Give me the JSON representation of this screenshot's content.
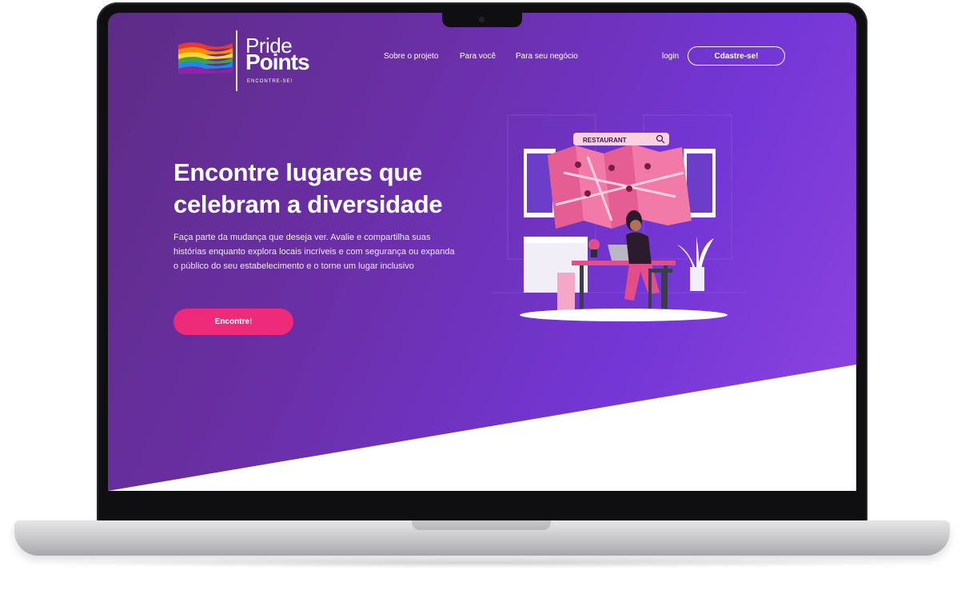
{
  "brand": {
    "name_line1": "Pride",
    "name_line2": "Points",
    "tagline": "ENCONTRE-SE!"
  },
  "nav": {
    "items": [
      "Sobre o projeto",
      "Para você",
      "Para seu negócio"
    ],
    "login": "login",
    "signup": "Cdastre-se!"
  },
  "hero": {
    "title_line1": "Encontre lugares que",
    "title_line2": "celebram a diversidade",
    "description": "Faça parte da mudança que deseja ver. Avalie e compartilha suas histórias enquanto explora locais incríveis e com segurança ou expanda o público do seu estabelecimento e o torne um lugar inclusivo",
    "cta": "Encontre!"
  },
  "illustration": {
    "search_text": "RESTAURANT",
    "icons": [
      "map-icon",
      "search-icon",
      "laptop-icon",
      "plant-icon"
    ]
  },
  "colors": {
    "gradient_start": "#5e2c86",
    "gradient_end": "#8f45e0",
    "accent_pink": "#ee2a7b",
    "frame": "#0f0f12"
  }
}
